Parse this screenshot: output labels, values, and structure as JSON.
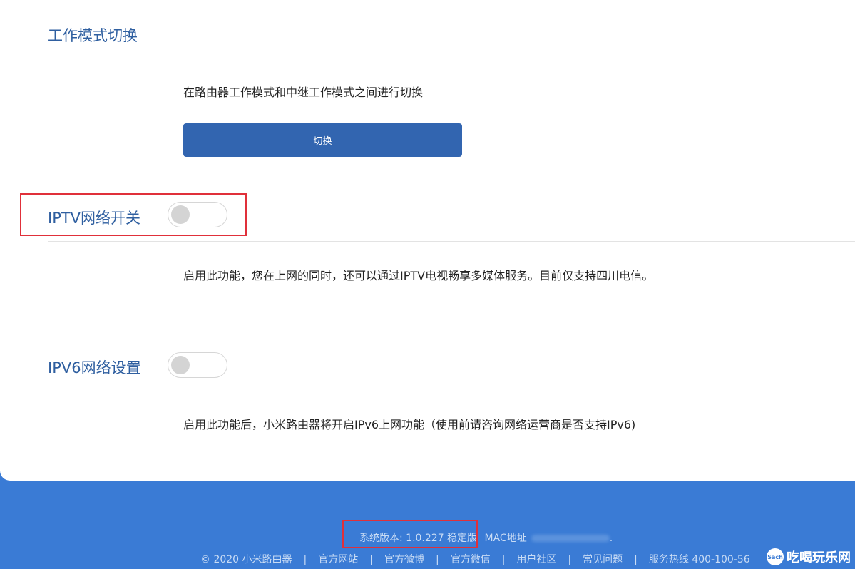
{
  "mode_switch": {
    "title": "工作模式切换",
    "description": "在路由器工作模式和中继工作模式之间进行切换",
    "button_label": "切换"
  },
  "iptv": {
    "title": "IPTV网络开关",
    "enabled": false,
    "description": "启用此功能，您在上网的同时，还可以通过IPTV电视畅享多媒体服务。目前仅支持四川电信。"
  },
  "ipv6": {
    "title": "IPV6网络设置",
    "enabled": false,
    "description": "启用此功能后，小米路由器将开启IPv6上网功能（使用前请咨询网络运营商是否支持IPv6)"
  },
  "footer": {
    "version": "系统版本: 1.0.227 稳定版",
    "mac_label": "MAC地址",
    "mac_suffix": ".",
    "links": [
      "© 2020 小米路由器",
      "官方网站",
      "官方微博",
      "官方微信",
      "用户社区",
      "常见问题",
      "服务热线 400-100-56"
    ],
    "separator": "|"
  },
  "watermark": {
    "icon_text": "Sach",
    "text": "吃喝玩乐网"
  },
  "colors": {
    "accent": "#3265b0",
    "footer_bg": "#3a7bd5",
    "highlight": "#e0303a"
  }
}
